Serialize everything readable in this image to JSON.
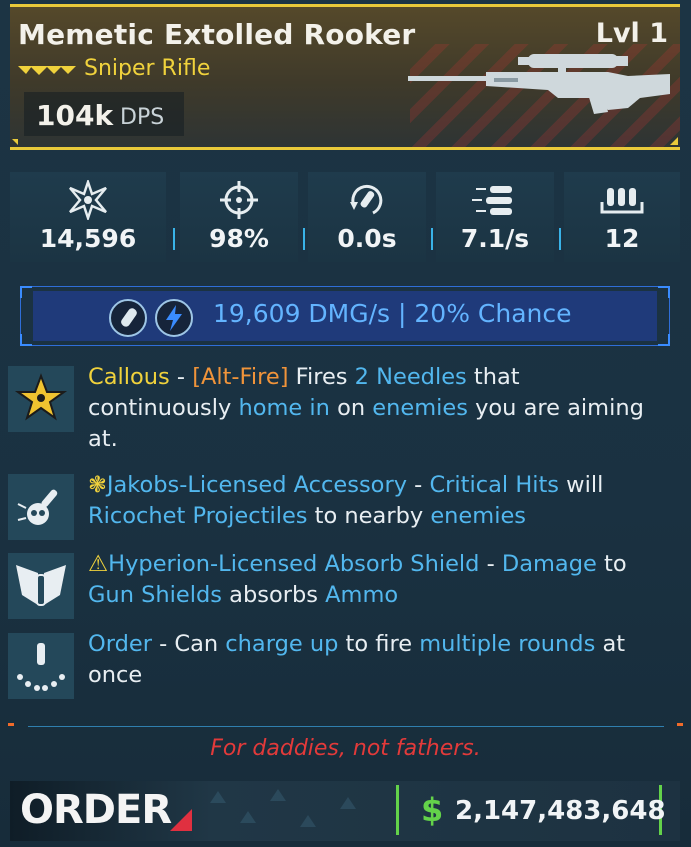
{
  "item": {
    "name": "Memetic Extolled Rooker",
    "level": "Lvl 1",
    "weapon_type": "Sniper Rifle",
    "dps_value": "104k",
    "dps_unit": "DPS",
    "rarity_color": "#e9c93a"
  },
  "stats": [
    {
      "icon": "damage-burst-icon",
      "value": "14,596"
    },
    {
      "icon": "crosshair-icon",
      "value": "98%"
    },
    {
      "icon": "reload-icon",
      "value": "0.0s"
    },
    {
      "icon": "fire-rate-icon",
      "value": "7.1/s"
    },
    {
      "icon": "magazine-icon",
      "value": "12"
    }
  ],
  "elemental": {
    "text": "19,609 DMG/s | 20% Chance",
    "element": "shock",
    "color": "#63b4ff"
  },
  "perks": [
    {
      "icon": "star-badge-icon",
      "parts": [
        {
          "t": "Callous",
          "c": "yl"
        },
        {
          "t": " - ",
          "c": ""
        },
        {
          "t": "[Alt-Fire]",
          "c": "or"
        },
        {
          "t": " Fires ",
          "c": ""
        },
        {
          "t": "2 Needles",
          "c": "hl"
        },
        {
          "t": " that continuously ",
          "c": ""
        },
        {
          "t": "home in",
          "c": "hl"
        },
        {
          "t": " on ",
          "c": ""
        },
        {
          "t": "enemies",
          "c": "hl"
        },
        {
          "t": " you are aiming at.",
          "c": ""
        }
      ]
    },
    {
      "icon": "skull-accessory-icon",
      "parts": [
        {
          "t": "❃",
          "c": "yl"
        },
        {
          "t": "Jakobs-Licensed Accessory",
          "c": "hl"
        },
        {
          "t": " - ",
          "c": ""
        },
        {
          "t": "Critical Hits",
          "c": "hl"
        },
        {
          "t": " will ",
          "c": ""
        },
        {
          "t": "Ricochet Projectiles",
          "c": "hl"
        },
        {
          "t": " to nearby ",
          "c": ""
        },
        {
          "t": "enemies",
          "c": "hl"
        }
      ]
    },
    {
      "icon": "absorb-shield-icon",
      "parts": [
        {
          "t": "⚠",
          "c": "yl"
        },
        {
          "t": "Hyperion-Licensed Absorb Shield",
          "c": "hl"
        },
        {
          "t": " - ",
          "c": ""
        },
        {
          "t": "Damage",
          "c": "hl"
        },
        {
          "t": " to ",
          "c": ""
        },
        {
          "t": "Gun Shields",
          "c": "hl"
        },
        {
          "t": " absorbs ",
          "c": ""
        },
        {
          "t": "Ammo",
          "c": "hl"
        }
      ]
    },
    {
      "icon": "charge-rounds-icon",
      "parts": [
        {
          "t": "Order",
          "c": "hl"
        },
        {
          "t": " - Can ",
          "c": ""
        },
        {
          "t": "charge up",
          "c": "hl"
        },
        {
          "t": " to fire ",
          "c": ""
        },
        {
          "t": "multiple rounds",
          "c": "hl"
        },
        {
          "t": " at once",
          "c": ""
        }
      ]
    }
  ],
  "flavor_text": "For daddies, not fathers.",
  "manufacturer": "ORDER",
  "price": {
    "symbol": "$",
    "value": "2,147,483,648",
    "color": "#63d24a"
  }
}
